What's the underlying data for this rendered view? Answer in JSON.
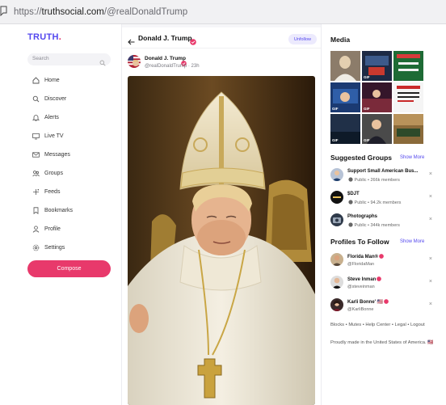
{
  "browser": {
    "url_scheme": "https://",
    "url_host": "truthsocial.com",
    "url_path": "/@realDonaldTrump"
  },
  "sidebar": {
    "logo": "TRUTH",
    "logo_dot": ".",
    "search_placeholder": "Search",
    "items": [
      {
        "label": "Home",
        "icon": "home-icon"
      },
      {
        "label": "Discover",
        "icon": "search-icon"
      },
      {
        "label": "Alerts",
        "icon": "bell-icon"
      },
      {
        "label": "Live TV",
        "icon": "tv-icon"
      },
      {
        "label": "Messages",
        "icon": "mail-icon"
      },
      {
        "label": "Groups",
        "icon": "groups-icon"
      },
      {
        "label": "Feeds",
        "icon": "feeds-icon"
      },
      {
        "label": "Bookmarks",
        "icon": "bookmark-icon"
      },
      {
        "label": "Profile",
        "icon": "profile-icon"
      },
      {
        "label": "Settings",
        "icon": "gear-icon"
      }
    ],
    "compose_label": "Compose"
  },
  "profile": {
    "name": "Donald J. Trump",
    "unfollow_label": "Unfollow"
  },
  "post": {
    "author": "Donald J. Trump",
    "handle": "@realDonaldTrump · 23h"
  },
  "right": {
    "media_title": "Media",
    "media_tiles": [
      {
        "gif": ""
      },
      {
        "gif": "GIF"
      },
      {
        "gif": ""
      },
      {
        "gif": "GIF"
      },
      {
        "gif": "GIF"
      },
      {
        "gif": ""
      },
      {
        "gif": "GIF"
      },
      {
        "gif": "GIF"
      },
      {
        "gif": ""
      }
    ],
    "groups_title": "Suggested Groups",
    "groups_show_more": "Show More",
    "groups": [
      {
        "name": "Support Small American Bus...",
        "meta": "Public • 266k members"
      },
      {
        "name": "$DJT",
        "meta": "Public • 94.2k members"
      },
      {
        "name": "Photographs",
        "meta": "Public • 344k members"
      }
    ],
    "profiles_title": "Profiles To Follow",
    "profiles_show_more": "Show More",
    "profiles": [
      {
        "name": "Florida Man®",
        "handle": "@FloridaMan"
      },
      {
        "name": "Steve Inman",
        "handle": "@steveinman"
      },
      {
        "name": "Karli Bonne' 🇺🇸",
        "handle": "@KarliBonne"
      }
    ],
    "footer_links": "Blocks • Mutes • Help Center • Legal • Logout",
    "footer_made": "Proudly made in the United States of America. 🇺🇸",
    "close_symbol": "×"
  },
  "colors": {
    "brand": "#5448ee",
    "compose": "#e8396b",
    "badge": "#e8396b"
  }
}
